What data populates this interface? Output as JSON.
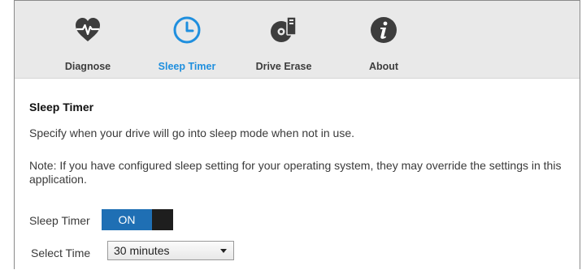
{
  "toolbar": {
    "items": [
      {
        "label": "Diagnose",
        "icon": "heart-pulse-icon",
        "active": false
      },
      {
        "label": "Sleep Timer",
        "icon": "clock-icon",
        "active": true
      },
      {
        "label": "Drive Erase",
        "icon": "drive-erase-icon",
        "active": false
      },
      {
        "label": "About",
        "icon": "info-icon",
        "active": false
      }
    ],
    "active_color": "#1f8fde",
    "icon_color": "#3d3d3d"
  },
  "sleep_timer": {
    "title": "Sleep Timer",
    "description": "Specify when your drive will go into sleep mode when not in use.",
    "note": "Note: If you have configured sleep setting for your operating system, they may override the settings in this application.",
    "toggle_label": "Sleep Timer",
    "toggle_state": "ON",
    "toggle_color": "#1f6fb4",
    "select_label": "Select Time",
    "select_value": "30 minutes"
  }
}
